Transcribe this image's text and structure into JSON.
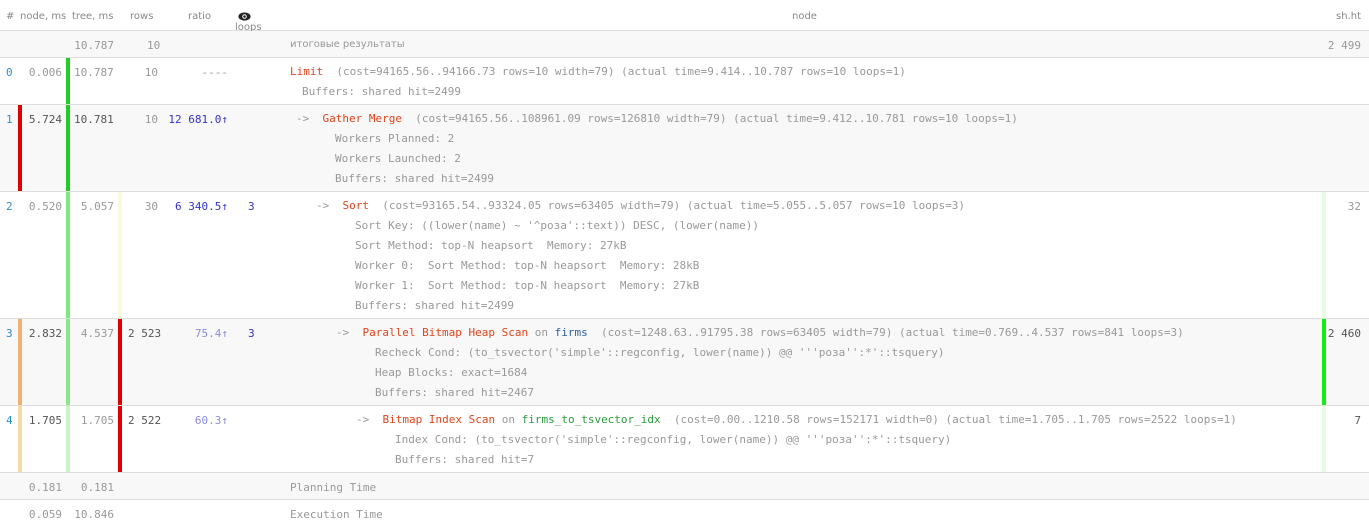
{
  "header": {
    "index": "#",
    "node_ms": "node, ms",
    "tree_ms": "tree, ms",
    "rows": "rows",
    "ratio": "ratio",
    "loops": "loops",
    "loops_icon": "eye-icon",
    "node": "node",
    "shared_hit": "sh.ht"
  },
  "summary": {
    "tree_ms": "10.787",
    "rows": "10",
    "label": "итоговые результаты",
    "shared_hit": "2 499"
  },
  "nodes": [
    {
      "index": "0",
      "node_ms": "0.006",
      "tree_ms": "10.787",
      "rows": "10",
      "ratio": "----",
      "loops": "",
      "shared_hit": "",
      "arrow": "",
      "operation": "Limit",
      "on": "",
      "relation": "",
      "details": "  (cost=94165.56..94166.73 rows=10 width=79) (actual time=9.414..10.787 rows=10 loops=1)",
      "extra": [
        "Buffers: shared hit=2499"
      ],
      "bars": {
        "node": "",
        "tree": "#22cc22",
        "rows": "",
        "shared_hit": ""
      }
    },
    {
      "index": "1",
      "node_ms": "5.724",
      "tree_ms": "10.781",
      "rows": "10",
      "ratio": "12 681.0↑",
      "loops": "",
      "shared_hit": "",
      "arrow": "->  ",
      "operation": "Gather Merge",
      "on": "",
      "relation": "",
      "details": "  (cost=94165.56..108961.09 rows=126810 width=79) (actual time=9.412..10.781 rows=10 loops=1)",
      "extra": [
        "Workers Planned: 2",
        "Workers Launched: 2",
        "Buffers: shared hit=2499"
      ],
      "bars": {
        "node": "#dd0000",
        "tree": "#22cc22",
        "rows": "",
        "shared_hit": ""
      }
    },
    {
      "index": "2",
      "node_ms": "0.520",
      "tree_ms": "5.057",
      "rows": "30",
      "ratio": "6 340.5↑",
      "loops": "3",
      "shared_hit": "32",
      "arrow": "->  ",
      "operation": "Sort",
      "on": "",
      "relation": "",
      "details": "  (cost=93165.54..93324.05 rows=63405 width=79) (actual time=5.055..5.057 rows=10 loops=3)",
      "extra": [
        "Sort Key: ((lower(name) ~ '^роза'::text)) DESC, (lower(name))",
        "Sort Method: top-N heapsort  Memory: 27kB",
        "Worker 0:  Sort Method: top-N heapsort  Memory: 28kB",
        "Worker 1:  Sort Method: top-N heapsort  Memory: 27kB",
        "Buffers: shared hit=2499"
      ],
      "bars": {
        "node": "",
        "tree": "#7ee87e",
        "rows": "#fafae0",
        "shared_hit": "#e4fbe4"
      }
    },
    {
      "index": "3",
      "node_ms": "2.832",
      "tree_ms": "4.537",
      "rows": "2 523",
      "ratio": "75.4↑",
      "loops": "3",
      "shared_hit": "2 460",
      "arrow": "->  ",
      "operation": "Parallel Bitmap Heap Scan",
      "on": " on ",
      "relation": "firms",
      "details": "  (cost=1248.63..91795.38 rows=63405 width=79) (actual time=0.769..4.537 rows=841 loops=3)",
      "extra": [
        "Recheck Cond: (to_tsvector('simple'::regconfig, lower(name)) @@ '''роза'':*'::tsquery)",
        "Heap Blocks: exact=1684",
        "Buffers: shared hit=2467"
      ],
      "bars": {
        "node": "#f0b070",
        "tree": "#88e888",
        "rows": "#dd0000",
        "shared_hit": "#11ee11"
      }
    },
    {
      "index": "4",
      "node_ms": "1.705",
      "tree_ms": "1.705",
      "rows": "2 522",
      "ratio": "60.3↑",
      "loops": "",
      "shared_hit": "7",
      "arrow": "->  ",
      "operation": "Bitmap Index Scan",
      "on": " on ",
      "relation": "firms_to_tsvector_idx",
      "details": "  (cost=0.00..1210.58 rows=152171 width=0) (actual time=1.705..1.705 rows=2522 loops=1)",
      "extra": [
        "Index Cond: (to_tsvector('simple'::regconfig, lower(name)) @@ '''роза'':*'::tsquery)",
        "Buffers: shared hit=7"
      ],
      "bars": {
        "node": "#f5dba0",
        "tree": "#c8f4c8",
        "rows": "#dd0000",
        "shared_hit": "#e4fbe4"
      }
    }
  ],
  "footer": [
    {
      "node_ms": "0.181",
      "tree_ms": "0.181",
      "label": "Planning Time"
    },
    {
      "node_ms": "0.059",
      "tree_ms": "10.846",
      "label": "Execution Time"
    }
  ]
}
